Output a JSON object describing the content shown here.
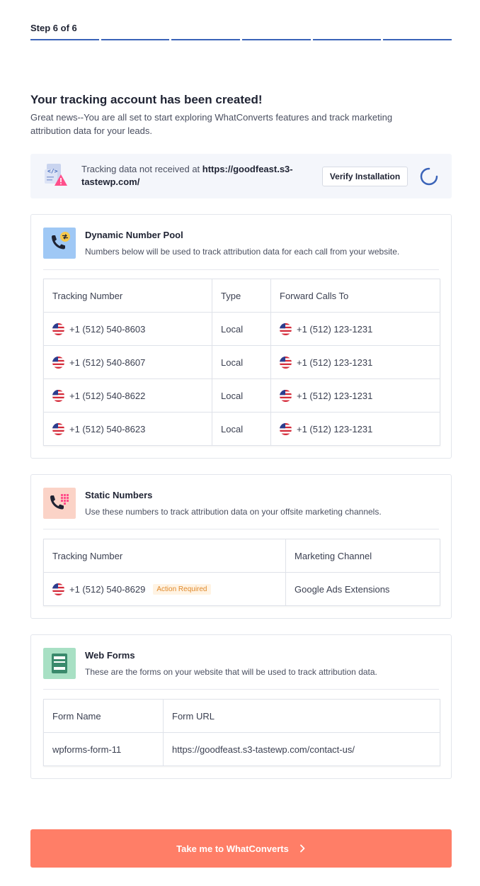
{
  "progress": {
    "label": "Step 6 of 6",
    "total": 6,
    "completed": 6,
    "color": "#3a63b8"
  },
  "header": {
    "title": "Your tracking account has been created!",
    "subtitle": "Great news--You are all set to start exploring WhatConverts features and track marketing attribution data for your leads."
  },
  "alert": {
    "message_prefix": "Tracking data not received at ",
    "url": "https://goodfeast.s3-tastewp.com/",
    "verify_label": "Verify Installation",
    "icon": "code-document-warning-icon",
    "spinner_icon": "loading-spinner-icon"
  },
  "dynamic_pool": {
    "title": "Dynamic Number Pool",
    "description": "Numbers below will be used to track attribution data for each call from your website.",
    "icon": "phone-swap-icon",
    "columns": [
      "Tracking Number",
      "Type",
      "Forward Calls To"
    ],
    "rows": [
      {
        "tracking": "+1 (512) 540-8603",
        "type": "Local",
        "forward": "+1 (512) 123-1231"
      },
      {
        "tracking": "+1 (512) 540-8607",
        "type": "Local",
        "forward": "+1 (512) 123-1231"
      },
      {
        "tracking": "+1 (512) 540-8622",
        "type": "Local",
        "forward": "+1 (512) 123-1231"
      },
      {
        "tracking": "+1 (512) 540-8623",
        "type": "Local",
        "forward": "+1 (512) 123-1231"
      }
    ]
  },
  "static_numbers": {
    "title": "Static Numbers",
    "description": "Use these numbers to track attribution data on your offsite marketing channels.",
    "icon": "phone-keypad-icon",
    "columns": [
      "Tracking Number",
      "Marketing Channel"
    ],
    "rows": [
      {
        "tracking": "+1 (512) 540-8629",
        "badge": "Action Required",
        "channel": "Google Ads Extensions"
      }
    ]
  },
  "web_forms": {
    "title": "Web Forms",
    "description": "These are the forms on your website that will be used to track attribution data.",
    "icon": "form-icon",
    "columns": [
      "Form Name",
      "Form URL"
    ],
    "rows": [
      {
        "name": "wpforms-form-11",
        "url": "https://goodfeast.s3-tastewp.com/contact-us/"
      }
    ]
  },
  "cta": {
    "label": "Take me to WhatConverts",
    "icon": "chevron-right-icon",
    "color": "#ff7e67"
  }
}
